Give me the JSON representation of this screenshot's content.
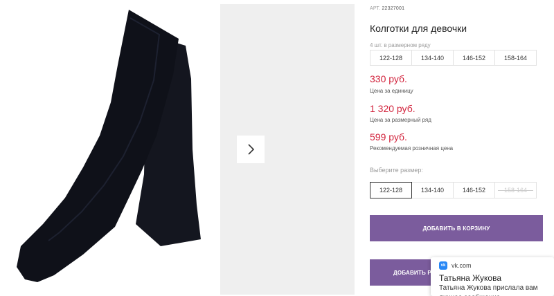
{
  "product": {
    "article_label": "АРТ.",
    "article_code": "22327001",
    "title": "Колготки для девочки",
    "pack_note": "4 шт. в размерном ряду",
    "pack_sizes": [
      "122-128",
      "134-140",
      "146-152",
      "158-164"
    ]
  },
  "prices": {
    "unit_price": "330 руб.",
    "unit_label": "Цена за единицу",
    "row_price": "1 320 руб.",
    "row_label": "Цена за размерный ряд",
    "retail_price": "599 руб.",
    "retail_label": "Рекомендуемая розничная цена"
  },
  "size_selector": {
    "label": "Выберите размер:",
    "options": [
      {
        "label": "122-128",
        "state": "selected"
      },
      {
        "label": "134-140",
        "state": "available"
      },
      {
        "label": "146-152",
        "state": "available"
      },
      {
        "label": "158-164",
        "state": "unavailable"
      }
    ]
  },
  "buttons": {
    "add_to_cart": "Добавить в корзину",
    "add_second": "Добавить р"
  },
  "notification": {
    "source": "vk.com",
    "from": "Татьяна Жукова",
    "message": "Татьяна Жукова прислала вам личное сообщение"
  },
  "icons": {
    "gallery_next": "chevron-right-icon",
    "vk": "vk-icon"
  },
  "colors": {
    "price_red": "#d2233c",
    "button_purple": "#7b5c9d",
    "vk_blue": "#2787f5"
  }
}
